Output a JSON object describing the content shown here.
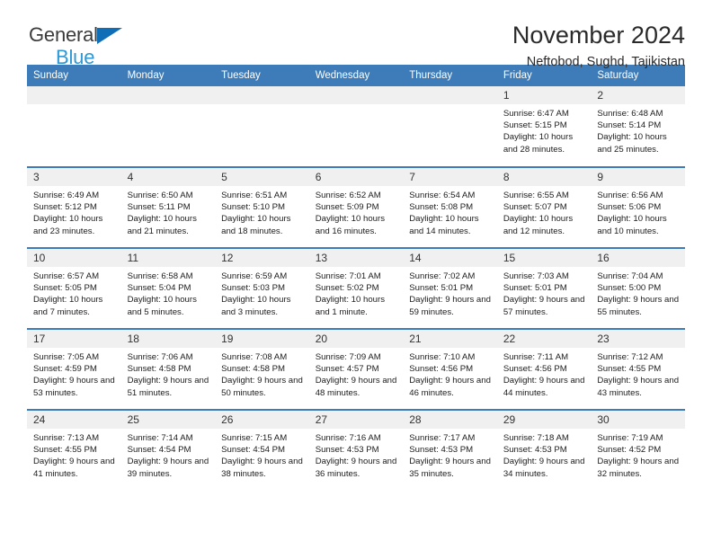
{
  "brand": {
    "name_line1": "General",
    "name_line2": "Blue",
    "triangle_color": "#0f6eb5",
    "line2_color": "#2e97d4"
  },
  "header": {
    "title": "November 2024",
    "location": "Neftobod, Sughd, Tajikistan"
  },
  "theme": {
    "header_blue": "#3d7cb8",
    "daynum_band": "#f0f0f0",
    "text": "#1c1c1c"
  },
  "weekdays": [
    "Sunday",
    "Monday",
    "Tuesday",
    "Wednesday",
    "Thursday",
    "Friday",
    "Saturday"
  ],
  "labels": {
    "sunrise_prefix": "Sunrise:",
    "sunset_prefix": "Sunset:",
    "daylight_prefix": "Daylight:"
  },
  "weeks": [
    [
      {
        "day": "",
        "empty": true
      },
      {
        "day": "",
        "empty": true
      },
      {
        "day": "",
        "empty": true
      },
      {
        "day": "",
        "empty": true
      },
      {
        "day": "",
        "empty": true
      },
      {
        "day": "1",
        "sunrise": "Sunrise: 6:47 AM",
        "sunset": "Sunset: 5:15 PM",
        "daylight": "Daylight: 10 hours and 28 minutes."
      },
      {
        "day": "2",
        "sunrise": "Sunrise: 6:48 AM",
        "sunset": "Sunset: 5:14 PM",
        "daylight": "Daylight: 10 hours and 25 minutes."
      }
    ],
    [
      {
        "day": "3",
        "sunrise": "Sunrise: 6:49 AM",
        "sunset": "Sunset: 5:12 PM",
        "daylight": "Daylight: 10 hours and 23 minutes."
      },
      {
        "day": "4",
        "sunrise": "Sunrise: 6:50 AM",
        "sunset": "Sunset: 5:11 PM",
        "daylight": "Daylight: 10 hours and 21 minutes."
      },
      {
        "day": "5",
        "sunrise": "Sunrise: 6:51 AM",
        "sunset": "Sunset: 5:10 PM",
        "daylight": "Daylight: 10 hours and 18 minutes."
      },
      {
        "day": "6",
        "sunrise": "Sunrise: 6:52 AM",
        "sunset": "Sunset: 5:09 PM",
        "daylight": "Daylight: 10 hours and 16 minutes."
      },
      {
        "day": "7",
        "sunrise": "Sunrise: 6:54 AM",
        "sunset": "Sunset: 5:08 PM",
        "daylight": "Daylight: 10 hours and 14 minutes."
      },
      {
        "day": "8",
        "sunrise": "Sunrise: 6:55 AM",
        "sunset": "Sunset: 5:07 PM",
        "daylight": "Daylight: 10 hours and 12 minutes."
      },
      {
        "day": "9",
        "sunrise": "Sunrise: 6:56 AM",
        "sunset": "Sunset: 5:06 PM",
        "daylight": "Daylight: 10 hours and 10 minutes."
      }
    ],
    [
      {
        "day": "10",
        "sunrise": "Sunrise: 6:57 AM",
        "sunset": "Sunset: 5:05 PM",
        "daylight": "Daylight: 10 hours and 7 minutes."
      },
      {
        "day": "11",
        "sunrise": "Sunrise: 6:58 AM",
        "sunset": "Sunset: 5:04 PM",
        "daylight": "Daylight: 10 hours and 5 minutes."
      },
      {
        "day": "12",
        "sunrise": "Sunrise: 6:59 AM",
        "sunset": "Sunset: 5:03 PM",
        "daylight": "Daylight: 10 hours and 3 minutes."
      },
      {
        "day": "13",
        "sunrise": "Sunrise: 7:01 AM",
        "sunset": "Sunset: 5:02 PM",
        "daylight": "Daylight: 10 hours and 1 minute."
      },
      {
        "day": "14",
        "sunrise": "Sunrise: 7:02 AM",
        "sunset": "Sunset: 5:01 PM",
        "daylight": "Daylight: 9 hours and 59 minutes."
      },
      {
        "day": "15",
        "sunrise": "Sunrise: 7:03 AM",
        "sunset": "Sunset: 5:01 PM",
        "daylight": "Daylight: 9 hours and 57 minutes."
      },
      {
        "day": "16",
        "sunrise": "Sunrise: 7:04 AM",
        "sunset": "Sunset: 5:00 PM",
        "daylight": "Daylight: 9 hours and 55 minutes."
      }
    ],
    [
      {
        "day": "17",
        "sunrise": "Sunrise: 7:05 AM",
        "sunset": "Sunset: 4:59 PM",
        "daylight": "Daylight: 9 hours and 53 minutes."
      },
      {
        "day": "18",
        "sunrise": "Sunrise: 7:06 AM",
        "sunset": "Sunset: 4:58 PM",
        "daylight": "Daylight: 9 hours and 51 minutes."
      },
      {
        "day": "19",
        "sunrise": "Sunrise: 7:08 AM",
        "sunset": "Sunset: 4:58 PM",
        "daylight": "Daylight: 9 hours and 50 minutes."
      },
      {
        "day": "20",
        "sunrise": "Sunrise: 7:09 AM",
        "sunset": "Sunset: 4:57 PM",
        "daylight": "Daylight: 9 hours and 48 minutes."
      },
      {
        "day": "21",
        "sunrise": "Sunrise: 7:10 AM",
        "sunset": "Sunset: 4:56 PM",
        "daylight": "Daylight: 9 hours and 46 minutes."
      },
      {
        "day": "22",
        "sunrise": "Sunrise: 7:11 AM",
        "sunset": "Sunset: 4:56 PM",
        "daylight": "Daylight: 9 hours and 44 minutes."
      },
      {
        "day": "23",
        "sunrise": "Sunrise: 7:12 AM",
        "sunset": "Sunset: 4:55 PM",
        "daylight": "Daylight: 9 hours and 43 minutes."
      }
    ],
    [
      {
        "day": "24",
        "sunrise": "Sunrise: 7:13 AM",
        "sunset": "Sunset: 4:55 PM",
        "daylight": "Daylight: 9 hours and 41 minutes."
      },
      {
        "day": "25",
        "sunrise": "Sunrise: 7:14 AM",
        "sunset": "Sunset: 4:54 PM",
        "daylight": "Daylight: 9 hours and 39 minutes."
      },
      {
        "day": "26",
        "sunrise": "Sunrise: 7:15 AM",
        "sunset": "Sunset: 4:54 PM",
        "daylight": "Daylight: 9 hours and 38 minutes."
      },
      {
        "day": "27",
        "sunrise": "Sunrise: 7:16 AM",
        "sunset": "Sunset: 4:53 PM",
        "daylight": "Daylight: 9 hours and 36 minutes."
      },
      {
        "day": "28",
        "sunrise": "Sunrise: 7:17 AM",
        "sunset": "Sunset: 4:53 PM",
        "daylight": "Daylight: 9 hours and 35 minutes."
      },
      {
        "day": "29",
        "sunrise": "Sunrise: 7:18 AM",
        "sunset": "Sunset: 4:53 PM",
        "daylight": "Daylight: 9 hours and 34 minutes."
      },
      {
        "day": "30",
        "sunrise": "Sunrise: 7:19 AM",
        "sunset": "Sunset: 4:52 PM",
        "daylight": "Daylight: 9 hours and 32 minutes."
      }
    ]
  ]
}
